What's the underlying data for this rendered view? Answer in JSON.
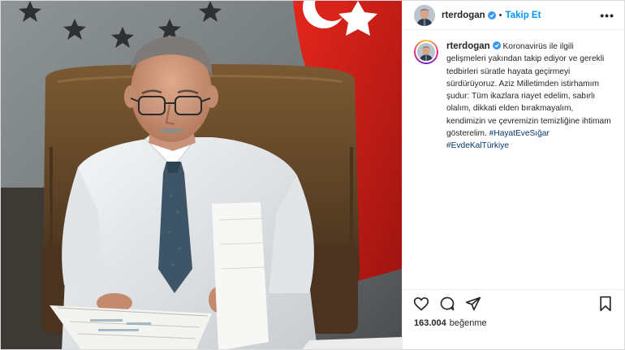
{
  "post": {
    "username": "rterdogan",
    "follow_label": "Takip Et",
    "separator": "•",
    "more_label": "•••",
    "caption_text": "Koronavirüs ile ilgili gelişmeleri yakından takip ediyor ve gerekli tedbirleri süratle hayata geçirmeyi sürdürüyoruz. Aziz Milletimden istirhamım şudur: Tüm ikazlara riayet edelim, sabırlı olalım, dikkati elden bırakmayalım, kendimizin ve çevremizin temizliğine ihtimam gösterelim.",
    "hashtags": [
      "#HayatEveSığar",
      "#EvdeKalTürkiye"
    ],
    "likes_count": "163.004",
    "likes_label": "beğenme"
  },
  "icons": {
    "verified": "verified-badge-icon",
    "like": "heart-icon",
    "comment": "comment-icon",
    "share": "share-icon",
    "save": "bookmark-icon",
    "more": "more-options-icon"
  },
  "colors": {
    "accent": "#0095f6",
    "verified": "#3897f0",
    "hashtag": "#00376b",
    "text": "#262626",
    "flag_red": "#e30a17"
  }
}
